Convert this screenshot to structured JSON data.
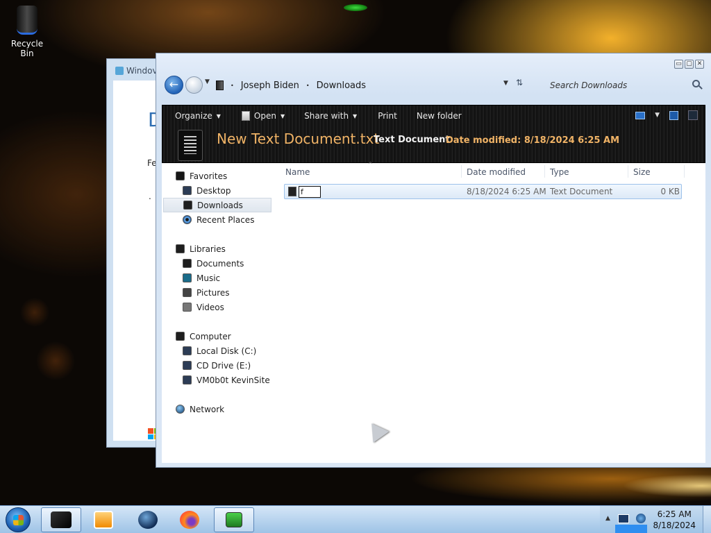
{
  "desktop": {
    "recycle_bin_label": "Recycle Bin"
  },
  "background_window": {
    "title": "Windov",
    "heading_fragment": "D",
    "text_fragment": "Feel",
    "dot": "."
  },
  "explorer": {
    "window_buttons": {
      "minimize": "▭",
      "maximize": "▢",
      "close": "✕"
    },
    "address": {
      "separator": "•",
      "crumbs": [
        "Joseph Biden",
        "Downloads"
      ]
    },
    "search": {
      "placeholder": "Search Downloads"
    },
    "commands": {
      "organize": "Organize",
      "open": "Open",
      "share_with": "Share with",
      "print": "Print",
      "new_folder": "New folder",
      "caret": "▼"
    },
    "details_pane": {
      "file_name": "New Text Document.txt",
      "file_type": "Text Document",
      "date_modified": "Date modified: 8/18/2024 6:25 AM"
    },
    "nav_pane": {
      "favorites": "Favorites",
      "desktop": "Desktop",
      "downloads": "Downloads",
      "recent_places": "Recent Places",
      "libraries": "Libraries",
      "documents": "Documents",
      "music": "Music",
      "pictures": "Pictures",
      "videos": "Videos",
      "computer": "Computer",
      "local_disk": "Local Disk (C:)",
      "cd_drive": "CD Drive (E:)",
      "network_drive": "VM0b0t KevinSite",
      "network": "Network"
    },
    "columns": {
      "name": "Name",
      "date_modified": "Date modified",
      "type": "Type",
      "size": "Size"
    },
    "files": [
      {
        "rename_value": "f",
        "date_modified": "8/18/2024 6:25 AM",
        "type": "Text Document",
        "size": "0 KB"
      }
    ]
  },
  "taskbar": {
    "clock_time": "6:25 AM",
    "clock_date": "8/18/2024"
  }
}
